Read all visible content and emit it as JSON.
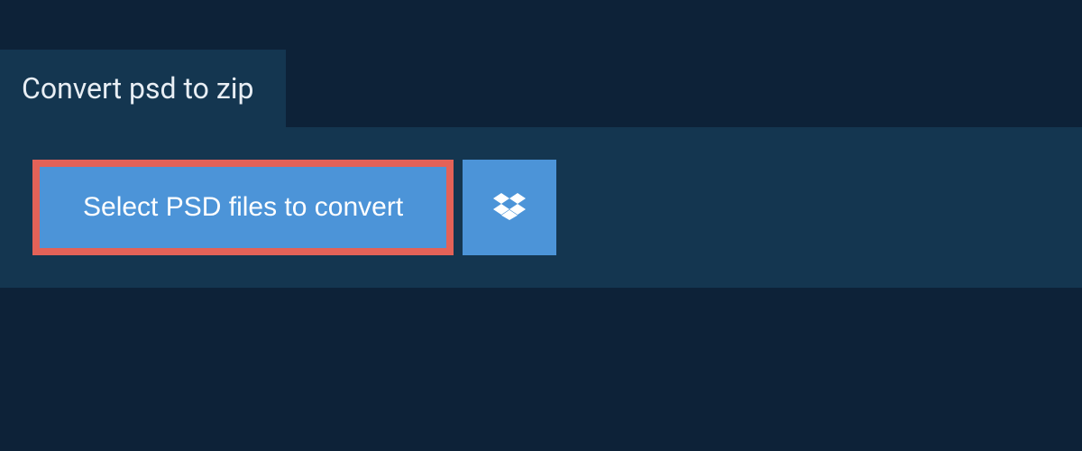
{
  "header": {
    "title": "Convert psd to zip"
  },
  "actions": {
    "select_files_label": "Select PSD files to convert",
    "dropbox_icon": "dropbox-icon"
  },
  "colors": {
    "background": "#0d2238",
    "panel": "#143650",
    "button": "#4c94d8",
    "highlight_border": "#e36258",
    "text_light": "#e8eef4",
    "text_button": "#ffffff"
  }
}
